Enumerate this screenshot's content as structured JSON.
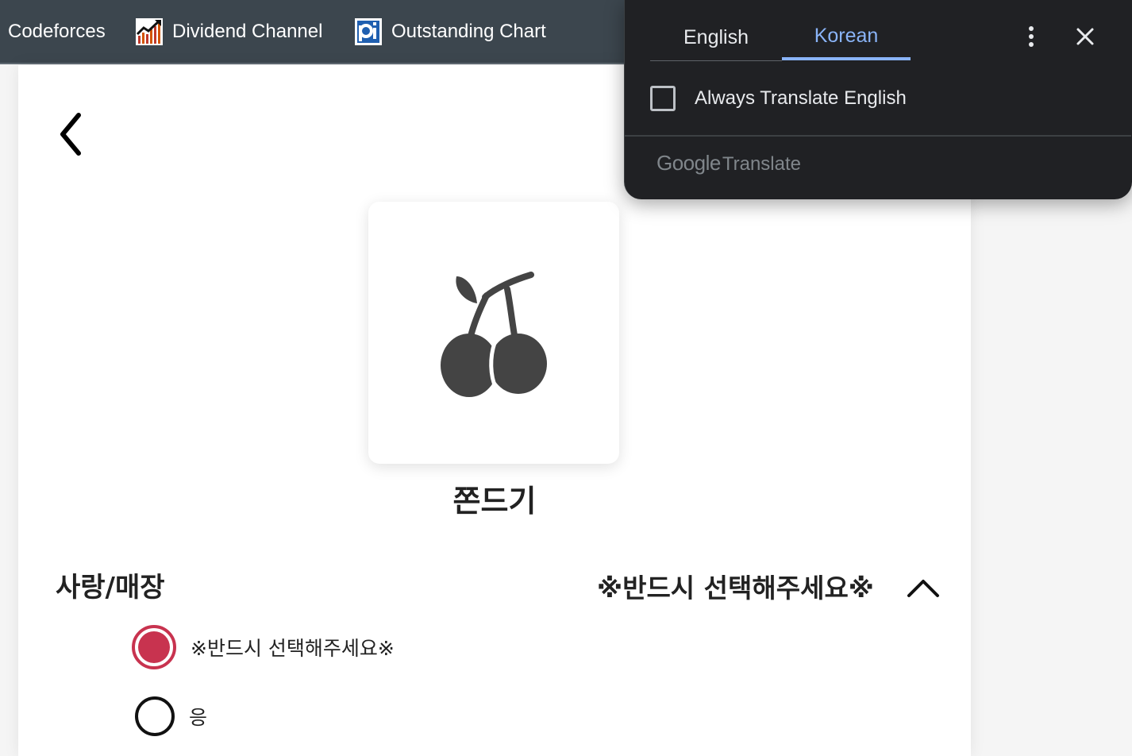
{
  "bookmarks": [
    {
      "label": "Codeforces",
      "icon": "none"
    },
    {
      "label": "Dividend Channel",
      "icon": "dividend-chart-icon"
    },
    {
      "label": "Outstanding Chart",
      "icon": "pi-logo-icon"
    }
  ],
  "translate_popup": {
    "tabs": [
      {
        "label": "English",
        "active": false
      },
      {
        "label": "Korean",
        "active": true
      }
    ],
    "always_translate_label": "Always Translate English",
    "always_translate_checked": false,
    "brand": {
      "google": "Google",
      "translate": "Translate"
    },
    "accent_color": "#8ab4f8"
  },
  "product": {
    "icon": "cherry-icon",
    "name": "쫀드기"
  },
  "option_group": {
    "title": "사랑/매장",
    "selected_value": "※반드시 선택해주세요※",
    "expanded": true,
    "options": [
      {
        "label": "※반드시 선택해주세요※",
        "checked": true
      },
      {
        "label": "응",
        "checked": false
      }
    ],
    "accent_color": "#c8334f"
  }
}
